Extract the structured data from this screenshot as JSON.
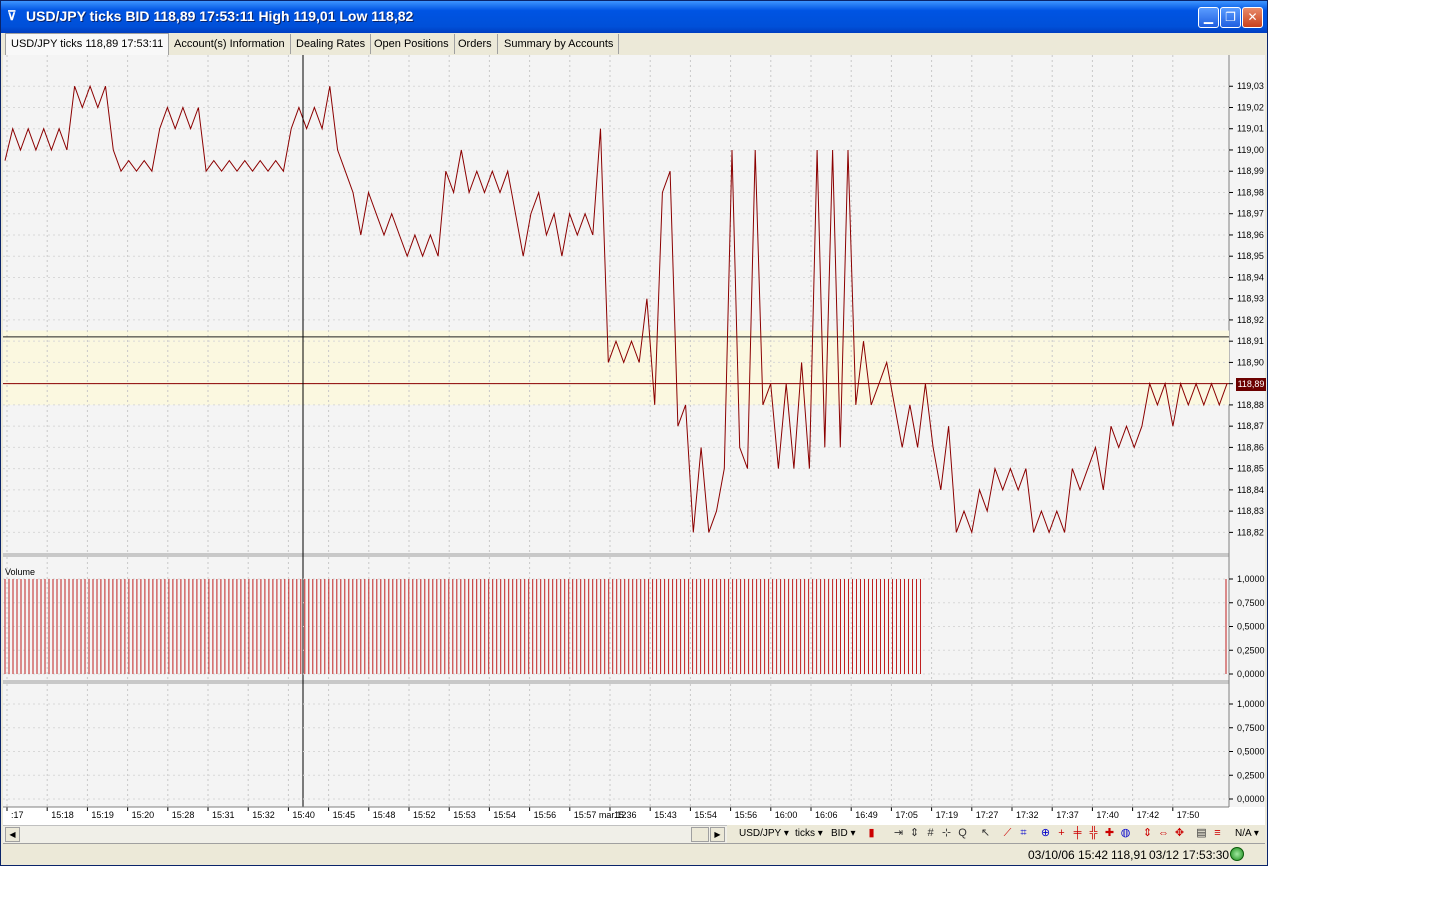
{
  "window": {
    "title": "USD/JPY ticks BID 118,89 17:53:11 High 119,01 Low 118,82",
    "icon": "logo-icon",
    "controls": [
      "minimize-icon",
      "restore-icon",
      "close-icon"
    ]
  },
  "tabs": [
    {
      "label": "USD/JPY ticks 118,89 17:53:11",
      "active": true
    },
    {
      "label": "Account(s) Information",
      "active": false
    },
    {
      "label": "Dealing Rates",
      "active": false
    },
    {
      "label": "Open Positions",
      "active": false
    },
    {
      "label": "Orders",
      "active": false
    },
    {
      "label": "Summary by Accounts",
      "active": false
    }
  ],
  "chart_data": [
    {
      "type": "line",
      "title": "",
      "series": [
        {
          "values": [
            118.995,
            119.01,
            119.0,
            119.01,
            119.0,
            119.01,
            119.0,
            119.01,
            119.0,
            119.03,
            119.02,
            119.03,
            119.02,
            119.03,
            119.0,
            118.99,
            118.995,
            118.99,
            118.995,
            118.99,
            119.01,
            119.02,
            119.01,
            119.02,
            119.01,
            119.02,
            118.99,
            118.995,
            118.99,
            118.995,
            118.99,
            118.995,
            118.99,
            118.995,
            118.99,
            118.995,
            118.99,
            119.01,
            119.02,
            119.01,
            119.02,
            119.01,
            119.03,
            119.0,
            118.99,
            118.98,
            118.96,
            118.98,
            118.97,
            118.96,
            118.97,
            118.96,
            118.95,
            118.96,
            118.95,
            118.96,
            118.95,
            118.99,
            118.98,
            119.0,
            118.98,
            118.99,
            118.98,
            118.99,
            118.98,
            118.99,
            118.97,
            118.95,
            118.97,
            118.98,
            118.96,
            118.97,
            118.95,
            118.97,
            118.96,
            118.97,
            118.96,
            119.01,
            118.9,
            118.91,
            118.9,
            118.91,
            118.9,
            118.93,
            118.88,
            118.98,
            118.99,
            118.87,
            118.88,
            118.82,
            118.86,
            118.82,
            118.83,
            118.85,
            119.0,
            118.86,
            118.85,
            119.0,
            118.88,
            118.89,
            118.85,
            118.89,
            118.85,
            118.9,
            118.85,
            119.0,
            118.86,
            119.0,
            118.86,
            119.0,
            118.88,
            118.91,
            118.88,
            118.89,
            118.9,
            118.88,
            118.86,
            118.88,
            118.86,
            118.89,
            118.86,
            118.84,
            118.87,
            118.82,
            118.83,
            118.82,
            118.84,
            118.83,
            118.85,
            118.84,
            118.85,
            118.84,
            118.85,
            118.82,
            118.83,
            118.82,
            118.83,
            118.82,
            118.85,
            118.84,
            118.85,
            118.86,
            118.84,
            118.87,
            118.86,
            118.87,
            118.86,
            118.87,
            118.89,
            118.88,
            118.89,
            118.87,
            118.89,
            118.88,
            118.89,
            118.88,
            118.89,
            118.88,
            118.89
          ]
        }
      ],
      "xlabel": "",
      "ylabel": "",
      "ylim": [
        118.815,
        119.04
      ],
      "y_ticks": [
        "119,03",
        "119,02",
        "119,01",
        "119,00",
        "118,99",
        "118,98",
        "118,97",
        "118,96",
        "118,95",
        "118,94",
        "118,93",
        "118,92",
        "118,91",
        "118,90",
        "118,89",
        "118,88",
        "118,87",
        "118,86",
        "118,85",
        "118,84",
        "118,83",
        "118,82"
      ],
      "x_ticks": [
        ":17",
        "15:18",
        "15:19",
        "15:20",
        "15:28",
        "15:31",
        "15:32",
        "15:40",
        "15:45",
        "15:48",
        "15:52",
        "15:53",
        "15:54",
        "15:56",
        "15:57 mar.12",
        "15:36",
        "15:43",
        "15:54",
        "15:56",
        "16:00",
        "16:06",
        "16:49",
        "17:05",
        "17:19",
        "17:27",
        "17:32",
        "17:37",
        "17:40",
        "17:42",
        "17:50"
      ],
      "current_price": "118,89",
      "horizontal_lines": [
        118.912,
        118.89
      ],
      "highlight_band": [
        118.88,
        118.915
      ],
      "grid": true,
      "colors": {
        "line": "#8b0000",
        "band": "#fbf8e0",
        "marker": "#6b0000"
      }
    },
    {
      "type": "bar",
      "title": "Volume",
      "bar_count": 230,
      "bar_value": 1.0,
      "fraction_of_width_filled": 0.75,
      "ylim": [
        0,
        1.0
      ],
      "y_ticks": [
        "1,0000",
        "0,7500",
        "0,5000",
        "0,2500",
        "0,0000"
      ],
      "grid": true,
      "colors": {
        "bar": "#c02020"
      }
    },
    {
      "type": "line",
      "title": "",
      "series": [],
      "ylim": [
        0,
        1.0
      ],
      "y_ticks": [
        "1,0000",
        "0,7500",
        "0,5000",
        "0,2500",
        "0,0000"
      ],
      "grid": true
    }
  ],
  "toolbar": {
    "instrument": "USD/JPY",
    "period": "ticks",
    "side": "BID",
    "na_label": "N/A",
    "icons": [
      "candle-icon",
      "scroll-end-icon",
      "zoom-vertical-icon",
      "grid-icon",
      "crosshair-icon",
      "q-icon",
      "pointer-icon",
      "trendline-icon",
      "fibo-icon",
      "zoom-in-icon",
      "cross-icon",
      "plus-icon",
      "hash-icon",
      "target-icon",
      "globe-icon",
      "bars-icon",
      "arrows-icon",
      "move-icon",
      "doc-icon",
      "settings-icon"
    ]
  },
  "status": {
    "cursor_time": "03/10/06 15:42",
    "cursor_price": "118,91",
    "server_time": "03/12 17:53:30"
  }
}
